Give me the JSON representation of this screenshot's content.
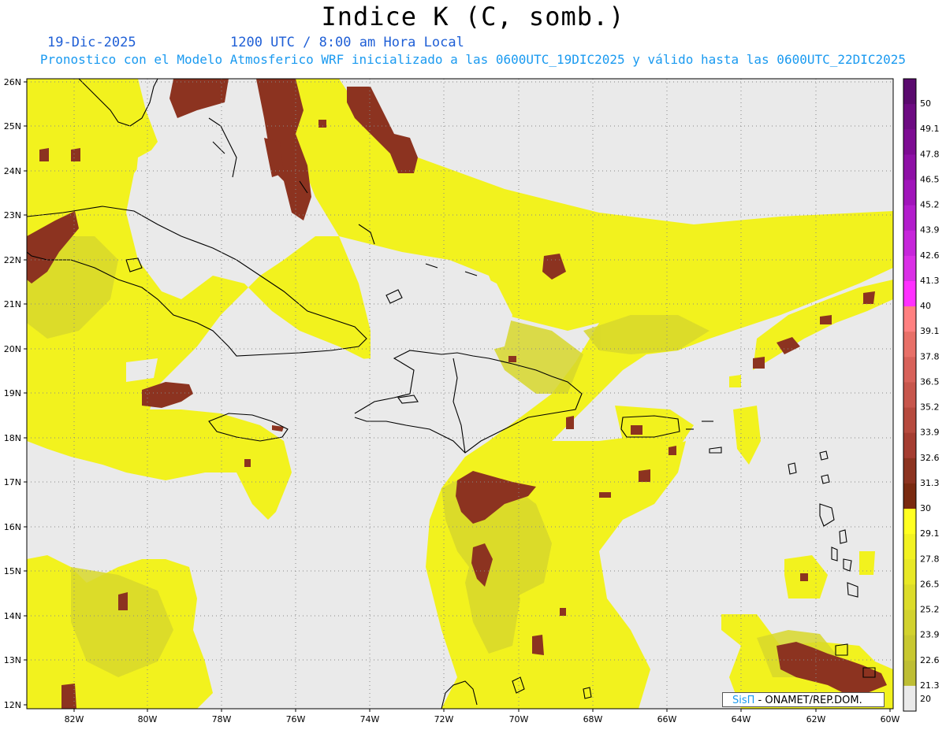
{
  "title": "Indice K (C, somb.)",
  "date_label": "19-Dic-2025",
  "time_label": "1200 UTC / 8:00 am Hora Local",
  "subtitle": "Pronostico con el Modelo Atmosferico WRF inicializado a las 0600UTC_19DIC2025 y válido hasta las  0600UTC_22DIC2025",
  "lat_labels": [
    "26N",
    "25N",
    "24N",
    "23N",
    "22N",
    "21N",
    "20N",
    "19N",
    "18N",
    "17N",
    "16N",
    "15N",
    "14N",
    "13N",
    "12N"
  ],
  "lon_labels": [
    "82W",
    "80W",
    "78W",
    "76W",
    "74W",
    "72W",
    "70W",
    "68W",
    "66W",
    "64W",
    "62W",
    "60W"
  ],
  "legend": {
    "labels": [
      "50",
      "49.1",
      "47.8",
      "46.5",
      "45.2",
      "43.9",
      "42.6",
      "41.3",
      "40",
      "39.1",
      "37.8",
      "36.5",
      "35.2",
      "33.9",
      "32.6",
      "31.3",
      "30",
      "29.1",
      "27.8",
      "26.5",
      "25.2",
      "23.9",
      "22.6",
      "21.3",
      "20"
    ],
    "colors": [
      "#5a0a6e",
      "#6d0b82",
      "#7d0c93",
      "#8e10a6",
      "#a015ba",
      "#b21dcc",
      "#c626da",
      "#da2fe6",
      "#ff30ff",
      "#ff8080",
      "#e87068",
      "#d8625a",
      "#c7564c",
      "#b64a3e",
      "#a53d31",
      "#8c3320",
      "#7a2a10",
      "#ffff20",
      "#f2f222",
      "#e8e826",
      "#dcdc2a",
      "#d2d22e",
      "#c8c830",
      "#bebe34",
      "#eaeaea"
    ]
  },
  "credit": {
    "brand": "SisΠ",
    "rest": " - ONAMET/REP.DOM."
  },
  "colors": {
    "background_field": "#eaeaea",
    "k_low": "#ffff20",
    "k_mid": "#d6d62c",
    "k_high": "#8c3320",
    "coast": "#000000"
  }
}
